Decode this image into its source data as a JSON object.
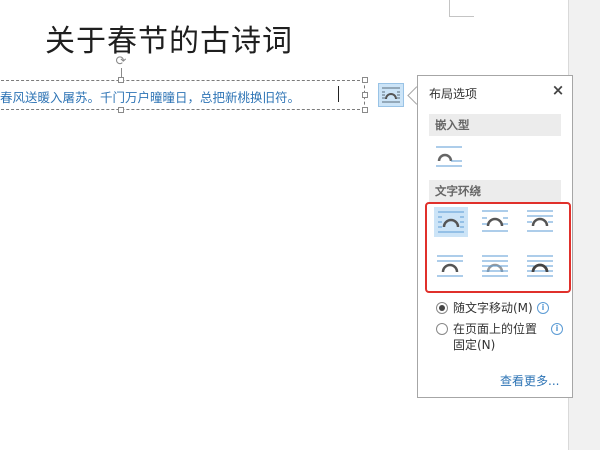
{
  "document": {
    "title": "关于春节的古诗词",
    "textbox_content": "春风送暖入屠苏。千门万户曈曈日，总把新桃换旧符。"
  },
  "layout_button": {
    "icon": "wrap-square-icon"
  },
  "panel": {
    "title": "布局选项",
    "close_icon": "×",
    "inline_section": {
      "label": "嵌入型",
      "icon": "inline-with-text-icon"
    },
    "wrap_section": {
      "label": "文字环绕",
      "options": [
        {
          "name": "square",
          "icon": "wrap-square-icon",
          "selected": true
        },
        {
          "name": "tight",
          "icon": "wrap-tight-icon",
          "selected": false
        },
        {
          "name": "through",
          "icon": "wrap-through-icon",
          "selected": false
        },
        {
          "name": "top-and-bottom",
          "icon": "wrap-top-bottom-icon",
          "selected": false
        },
        {
          "name": "behind-text",
          "icon": "wrap-behind-text-icon",
          "selected": false
        },
        {
          "name": "in-front-of-text",
          "icon": "wrap-in-front-icon",
          "selected": false
        }
      ]
    },
    "position_options": [
      {
        "label": "随文字移动(M)",
        "checked": true
      },
      {
        "label_line1": "在页面上的位置",
        "label_line2": "固定(N)",
        "checked": false
      }
    ],
    "see_more": "查看更多..."
  },
  "colors": {
    "accent_blue": "#2e74b5",
    "selection_blue": "#cce4f7",
    "highlight_red": "#e0302b"
  }
}
